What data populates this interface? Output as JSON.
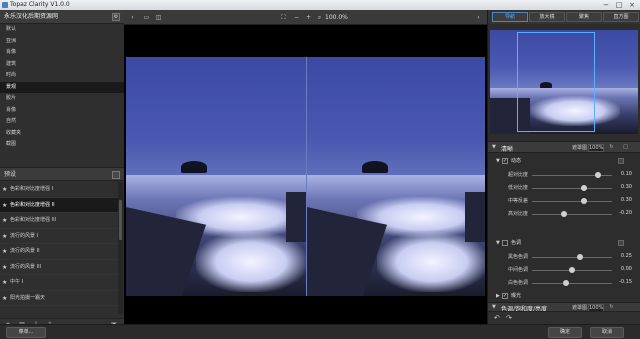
{
  "window": {
    "title": "Topaz Clarity V1.0.0",
    "controls": [
      "−",
      "□",
      "×"
    ]
  },
  "left_panel": {
    "header": "永乐汉化后期资源网",
    "menu": [
      "默认",
      "亚洲",
      "肖像",
      "建筑",
      "时尚",
      "景观",
      "胶片",
      "肖像",
      "自然",
      "收藏夹",
      "截图"
    ],
    "selected_menu_index": 5,
    "presets_header": "预设",
    "presets": [
      "色彩和对比度增强 I",
      "色彩和对比度增强 II",
      "色彩和对比度增强 III",
      "流行的风景 I",
      "流行的风景 II",
      "流行的风景 III",
      "中午 I",
      "阳光拍摄一霜天"
    ],
    "selected_preset_index": 1,
    "tool_icons": [
      "plus-icon",
      "trash-icon",
      "import-icon",
      "export-icon",
      "camera-icon"
    ]
  },
  "toolbar": {
    "zoom": "100.0%"
  },
  "right_panel": {
    "tabs": [
      "导航",
      "放大镜",
      "聚焦",
      "直方图"
    ],
    "selected_tab_index": 0,
    "clarity": {
      "title": "清晰",
      "mask_label": "遮罩图",
      "percent": "100%",
      "dynamics": {
        "label": "动态",
        "checked": true,
        "sliders": [
          {
            "label": "超对比度",
            "value": "0.10",
            "fraction": 0.82
          },
          {
            "label": "低对比度",
            "value": "0.30",
            "fraction": 0.65
          },
          {
            "label": "中等反差",
            "value": "0.30",
            "fraction": 0.65
          },
          {
            "label": "高对比度",
            "value": "-0.20",
            "fraction": 0.4
          }
        ]
      },
      "tone": {
        "label": "色调",
        "checked": false,
        "sliders": [
          {
            "label": "黑色色调",
            "value": "0.25",
            "fraction": 0.6
          },
          {
            "label": "中间色调",
            "value": "0.00",
            "fraction": 0.5
          },
          {
            "label": "白色色调",
            "value": "-0.15",
            "fraction": 0.42
          }
        ]
      },
      "exposure": {
        "label": "曝光",
        "checked": true
      }
    },
    "hsl": {
      "title": "色调/饱和度/亮度",
      "mask_label": "遮罩图",
      "percent": "100%"
    }
  },
  "bottom": {
    "import": "菜单...",
    "ok": "确定",
    "cancel": "取消"
  },
  "colors": {
    "accent": "#5ab0ff",
    "panel": "#2f2f2f"
  }
}
